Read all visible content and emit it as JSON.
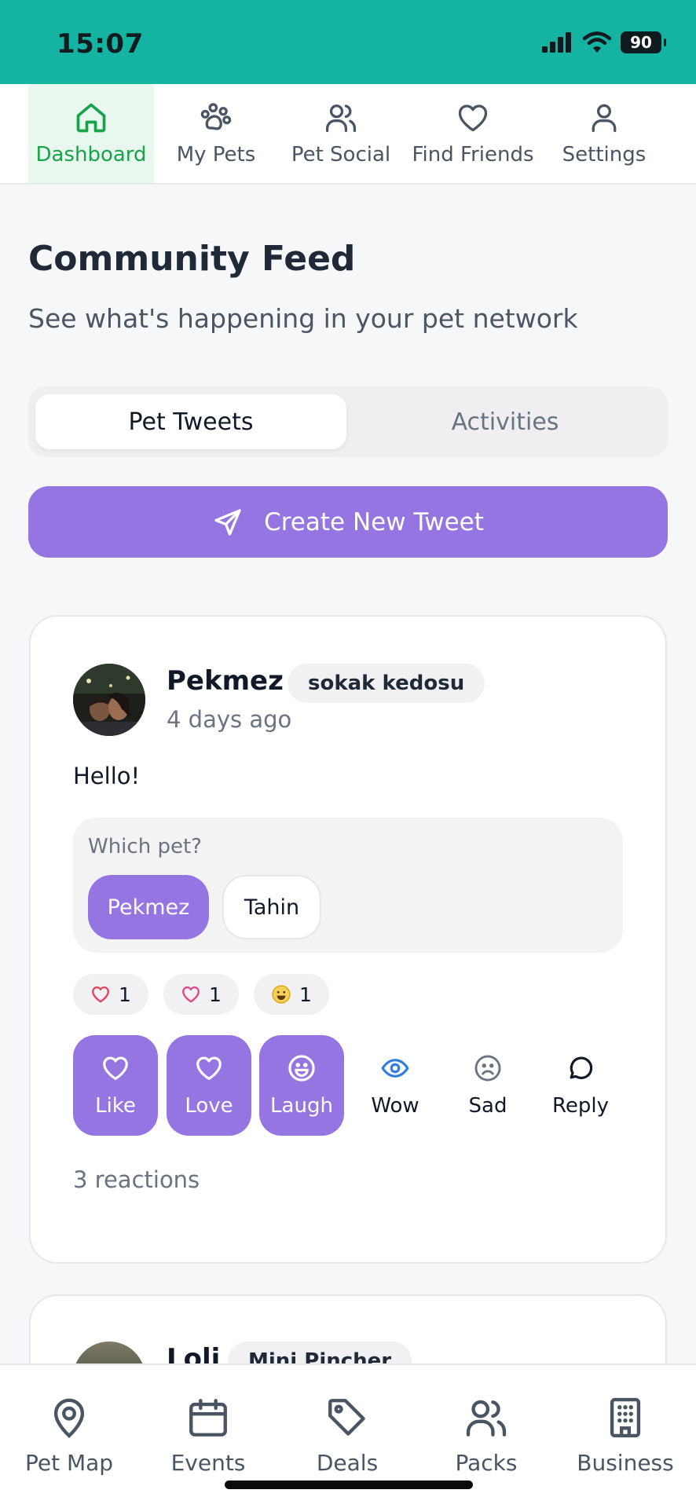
{
  "status_bar": {
    "time": "15:07",
    "battery": "90"
  },
  "top_nav": [
    {
      "label": "Dashboard",
      "icon": "home-icon",
      "active": true
    },
    {
      "label": "My Pets",
      "icon": "paw-icon",
      "active": false
    },
    {
      "label": "Pet Social",
      "icon": "users-icon",
      "active": false
    },
    {
      "label": "Find Friends",
      "icon": "heart-icon",
      "active": false
    },
    {
      "label": "Settings",
      "icon": "user-icon",
      "active": false
    }
  ],
  "page": {
    "title": "Community Feed",
    "subtitle": "See what's happening in your pet network"
  },
  "tabs": [
    {
      "label": "Pet Tweets",
      "active": true
    },
    {
      "label": "Activities",
      "active": false
    }
  ],
  "create_button": {
    "label": "Create New Tweet",
    "icon": "send-icon"
  },
  "post": {
    "author": "Pekmez",
    "breed": "sokak kedosu",
    "time": "4 days ago",
    "body": "Hello!",
    "pet_selector": {
      "label": "Which pet?",
      "options": [
        {
          "label": "Pekmez",
          "selected": true
        },
        {
          "label": "Tahin",
          "selected": false
        }
      ]
    },
    "reaction_counts": [
      {
        "icon": "heart-outline-icon",
        "count": "1",
        "color": "#E04561"
      },
      {
        "icon": "heart-pink-icon",
        "count": "1",
        "color": "#E0468B"
      },
      {
        "icon": "laugh-emoji-icon",
        "count": "1",
        "color": "#E0A91B"
      }
    ],
    "reaction_buttons": [
      {
        "label": "Like",
        "icon": "heart-icon",
        "active": true
      },
      {
        "label": "Love",
        "icon": "heart-icon",
        "active": true
      },
      {
        "label": "Laugh",
        "icon": "smile-icon",
        "active": true
      },
      {
        "label": "Wow",
        "icon": "eye-icon",
        "active": false
      },
      {
        "label": "Sad",
        "icon": "frown-icon",
        "active": false
      },
      {
        "label": "Reply",
        "icon": "chat-bubble-icon",
        "active": false
      }
    ],
    "reactions_total": "3 reactions"
  },
  "next_post": {
    "author": "Loli",
    "breed": "Mini Pincher"
  },
  "bottom_nav": [
    {
      "label": "Pet Map",
      "icon": "map-pin-icon"
    },
    {
      "label": "Events",
      "icon": "calendar-icon"
    },
    {
      "label": "Deals",
      "icon": "tag-icon"
    },
    {
      "label": "Packs",
      "icon": "users-icon"
    },
    {
      "label": "Business",
      "icon": "building-icon"
    }
  ],
  "colors": {
    "status_bar": "#15B3A2",
    "accent_purple": "#9575E2",
    "active_green": "#16A34A"
  }
}
